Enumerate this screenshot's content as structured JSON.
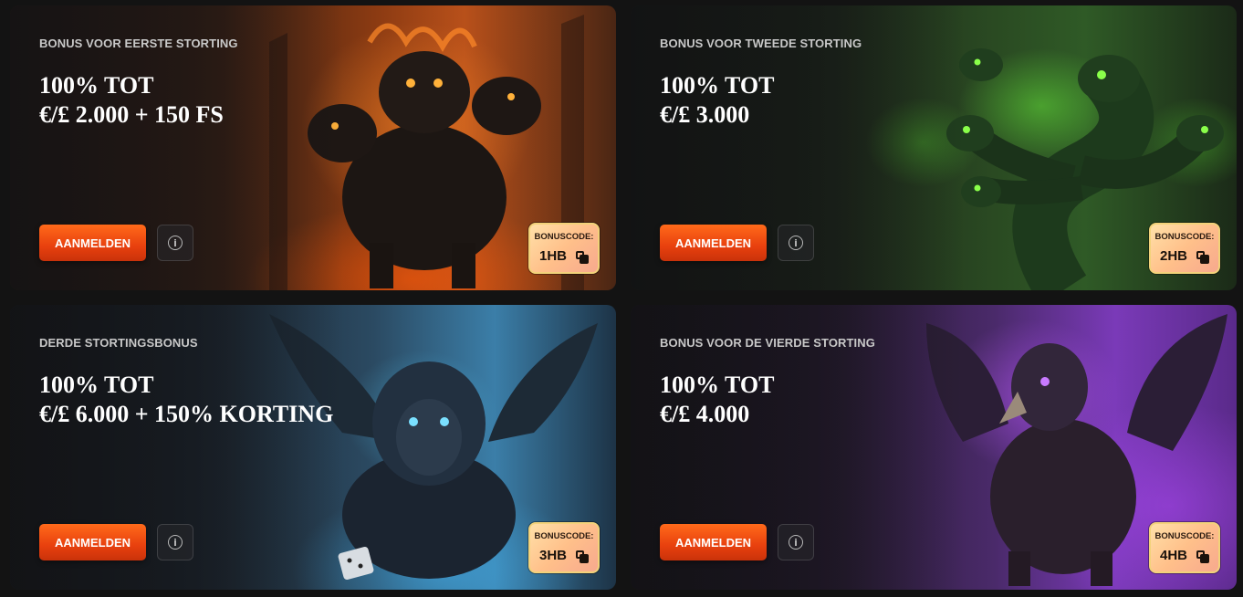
{
  "cards": [
    {
      "subtitle": "BONUS VOOR EERSTE STORTING",
      "headline_line1": "100% TOT",
      "headline_line2": "€/£ 2.000 + 150 FS",
      "signup_label": "AANMELDEN",
      "bonus_label": "BONUSCODE:",
      "bonus_code": "1HB",
      "creature_icon": "cerberus-illustration",
      "glow_color": "#ff7a1a"
    },
    {
      "subtitle": "BONUS VOOR TWEEDE STORTING",
      "headline_line1": "100% TOT",
      "headline_line2": "€/£ 3.000",
      "signup_label": "AANMELDEN",
      "bonus_label": "BONUSCODE:",
      "bonus_code": "2HB",
      "creature_icon": "hydra-illustration",
      "glow_color": "#7dff3a"
    },
    {
      "subtitle": "DERDE STORTINGSBONUS",
      "headline_line1": "100% TOT",
      "headline_line2": "€/£ 6.000 + 150% KORTING",
      "signup_label": "AANMELDEN",
      "bonus_label": "BONUSCODE:",
      "bonus_code": "3HB",
      "creature_icon": "winged-lion-illustration",
      "glow_color": "#5ad2ff"
    },
    {
      "subtitle": "BONUS VOOR DE VIERDE STORTING",
      "headline_line1": "100% TOT",
      "headline_line2": "€/£ 4.000",
      "signup_label": "AANMELDEN",
      "bonus_label": "BONUSCODE:",
      "bonus_code": "4HB",
      "creature_icon": "griffin-illustration",
      "glow_color": "#b85aff"
    }
  ],
  "info_icon": "info-icon",
  "copy_icon": "copy-icon",
  "accent_color": "#ff5a14",
  "background_color": "#131313"
}
